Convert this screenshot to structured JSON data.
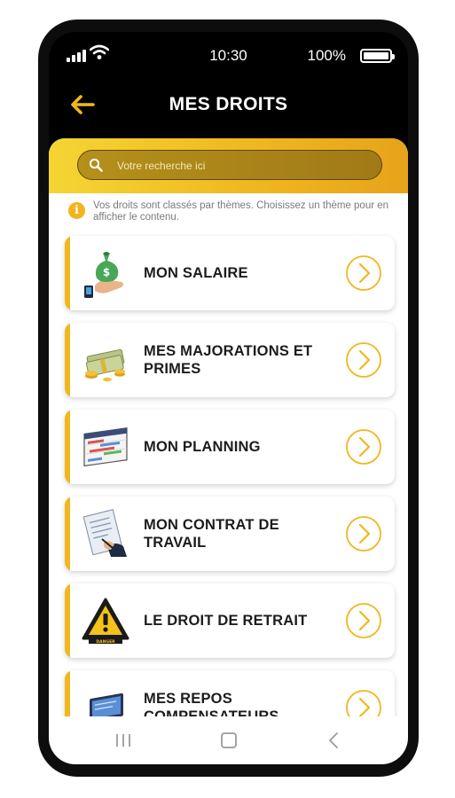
{
  "status_bar": {
    "time": "10:30",
    "battery": "100%"
  },
  "header": {
    "title": "MES DROITS",
    "back_icon": "arrow-left-icon",
    "accent": "#f0b71f"
  },
  "search": {
    "placeholder": "Votre recherche ici",
    "value": ""
  },
  "info": {
    "text": "Vos droits sont classés par thèmes. Choisissez un thème pour en afficher le contenu."
  },
  "themes": [
    {
      "label": "MON SALAIRE",
      "icon": "money-bag-hand-icon"
    },
    {
      "label": "MES MAJORATIONS ET PRIMES",
      "icon": "cash-coins-icon"
    },
    {
      "label": "MON PLANNING",
      "icon": "schedule-chart-icon"
    },
    {
      "label": "MON CONTRAT DE TRAVAIL",
      "icon": "contract-signing-icon"
    },
    {
      "label": "LE DROIT DE RETRAIT",
      "icon": "danger-warning-icon"
    },
    {
      "label": "MES REPOS COMPENSATEURS",
      "icon": "laptop-icon"
    }
  ],
  "colors": {
    "gold": "#f0b71f",
    "gold_light": "#f5d533",
    "dark": "#0d0d0d"
  }
}
